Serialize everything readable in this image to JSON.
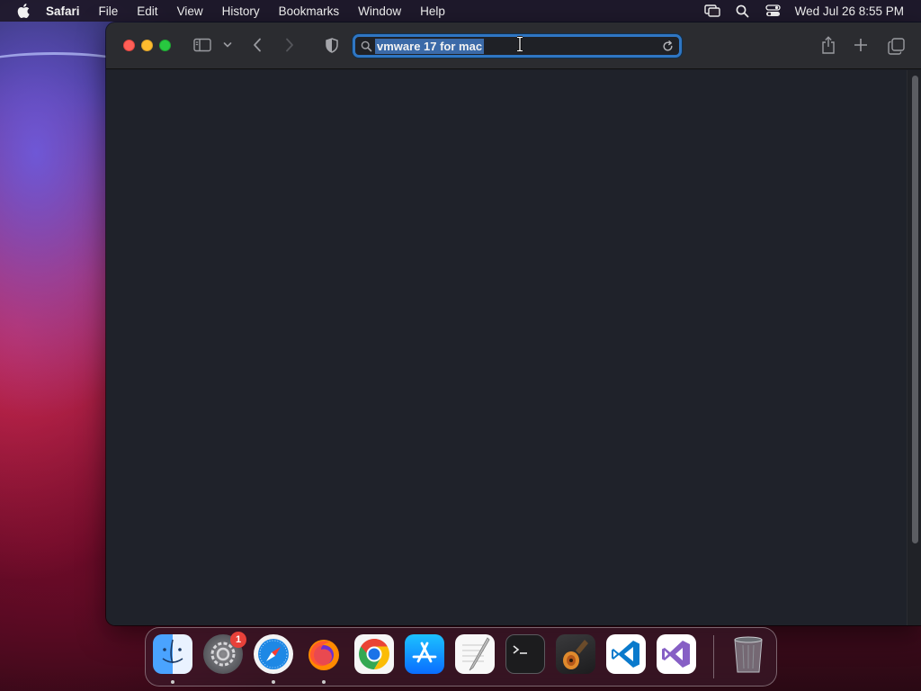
{
  "menubar": {
    "app_name": "Safari",
    "items": [
      "File",
      "Edit",
      "View",
      "History",
      "Bookmarks",
      "Window",
      "Help"
    ],
    "clock": "Wed Jul 26  8:55 PM"
  },
  "browser": {
    "address_value": "vmware 17 for mac"
  },
  "dock": {
    "apps": [
      "Finder",
      "System Settings",
      "Safari",
      "Firefox",
      "Google Chrome",
      "App Store",
      "TextEdit",
      "Terminal",
      "GarageBand",
      "Visual Studio Code",
      "Visual Studio",
      "Trash"
    ],
    "settings_badge": "1"
  },
  "colors": {
    "close": "#ff5f57",
    "minimize": "#febc2e",
    "maximize": "#28c840",
    "focus_ring": "#2f76c3",
    "selection": "#3b6aa8",
    "badge": "#e8413a"
  },
  "icons": [
    "apple-icon",
    "screen-mirroring-icon",
    "spotlight-search-icon",
    "control-center-icon",
    "sidebar-icon",
    "chevron-down-icon",
    "back-icon",
    "forward-icon",
    "shield-icon",
    "search-icon",
    "reload-icon",
    "ibeam-cursor-icon",
    "share-icon",
    "plus-icon",
    "tabs-overview-icon"
  ]
}
